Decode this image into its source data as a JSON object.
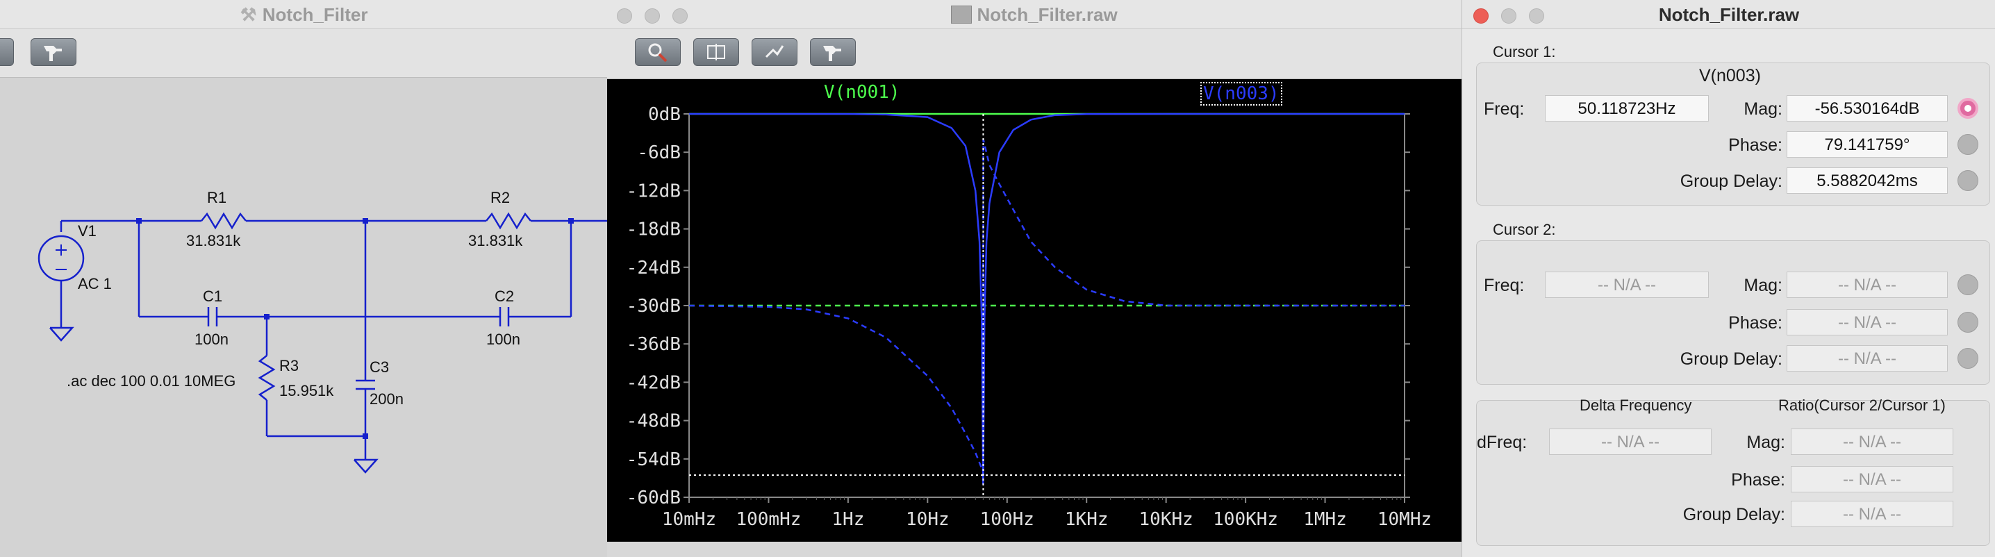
{
  "schematic": {
    "title": "Notch_Filter",
    "source": {
      "name": "V1",
      "value": "AC 1"
    },
    "r1": {
      "name": "R1",
      "value": "31.831k"
    },
    "r2": {
      "name": "R2",
      "value": "31.831k"
    },
    "r3": {
      "name": "R3",
      "value": "15.951k"
    },
    "c1": {
      "name": "C1",
      "value": "100n"
    },
    "c2": {
      "name": "C2",
      "value": "100n"
    },
    "c3": {
      "name": "C3",
      "value": "200n"
    },
    "directive": ".ac dec 100 0.01 10MEG"
  },
  "plot_window": {
    "title": "Notch_Filter.raw",
    "trace_labels": [
      "V(n001)",
      "V(n003)"
    ],
    "trace_colors": [
      "#4dff4d",
      "#2b3cff"
    ]
  },
  "chart_data": {
    "type": "line",
    "xscale": "log",
    "x_ticks": [
      "10mHz",
      "100mHz",
      "1Hz",
      "10Hz",
      "100Hz",
      "1KHz",
      "10KHz",
      "100KHz",
      "1MHz",
      "10MHz"
    ],
    "y_ticks": [
      "0dB",
      "-6dB",
      "-12dB",
      "-18dB",
      "-24dB",
      "-30dB",
      "-36dB",
      "-42dB",
      "-48dB",
      "-54dB",
      "-60dB"
    ],
    "ylim": [
      -60,
      0
    ],
    "xlim_hz": [
      0.01,
      10000000
    ],
    "grid": false,
    "series": [
      {
        "name": "V(n001)",
        "style": "magnitude-solid",
        "x_hz": [
          0.01,
          10000000
        ],
        "y_db": [
          0,
          0
        ]
      },
      {
        "name": "V(n001)",
        "style": "phase-dashed",
        "x_hz": [
          0.01,
          10000000
        ],
        "y_db": [
          -30,
          -30
        ]
      },
      {
        "name": "V(n003)",
        "style": "magnitude-solid",
        "x_hz": [
          0.01,
          0.1,
          1,
          3,
          10,
          20,
          30,
          40,
          45,
          48,
          50,
          52,
          55,
          60,
          80,
          120,
          200,
          400,
          1000,
          10000,
          10000000
        ],
        "y_db": [
          0,
          0,
          -0.01,
          -0.1,
          -0.5,
          -2.2,
          -5,
          -12,
          -20,
          -32,
          -58,
          -32,
          -20,
          -14,
          -6,
          -2.5,
          -0.9,
          -0.2,
          -0.03,
          0,
          0
        ]
      },
      {
        "name": "V(n003)",
        "style": "phase-dashed",
        "x_hz": [
          0.01,
          0.1,
          0.3,
          1,
          3,
          10,
          20,
          30,
          40,
          49.9,
          50.3,
          60,
          80,
          120,
          200,
          400,
          1000,
          3000,
          10000,
          10000000
        ],
        "y_db": [
          -30,
          -30.2,
          -30.6,
          -32,
          -35,
          -41,
          -46,
          -50,
          -53,
          -56,
          -4,
          -8,
          -11,
          -15,
          -20,
          -24,
          -27.5,
          -29.3,
          -30,
          -30
        ]
      }
    ],
    "cursor": {
      "freq_hz": 50.118723,
      "mag_db": -56.530164
    }
  },
  "cursor_panel": {
    "title": "Notch_Filter.raw",
    "cursor1": {
      "header": "Cursor 1:",
      "trace": "V(n003)",
      "freq_label": "Freq:",
      "freq": "50.118723Hz",
      "mag_label": "Mag:",
      "mag": "-56.530164dB",
      "phase_label": "Phase:",
      "phase": "79.141759°",
      "gd_label": "Group Delay:",
      "gd": "5.5882042ms"
    },
    "cursor2": {
      "header": "Cursor 2:",
      "freq_label": "Freq:",
      "freq": "-- N/A --",
      "mag_label": "Mag:",
      "mag": "-- N/A --",
      "phase_label": "Phase:",
      "phase": "-- N/A --",
      "gd_label": "Group Delay:",
      "gd": "-- N/A --"
    },
    "delta": {
      "delta_freq_header": "Delta Frequency",
      "ratio_header": "Ratio(Cursor 2/Cursor 1)",
      "dfreq_label": "dFreq:",
      "dfreq": "-- N/A --",
      "mag_label": "Mag:",
      "mag": "-- N/A --",
      "phase_label": "Phase:",
      "phase": "-- N/A --",
      "gd_label": "Group Delay:",
      "gd": "-- N/A --"
    }
  }
}
